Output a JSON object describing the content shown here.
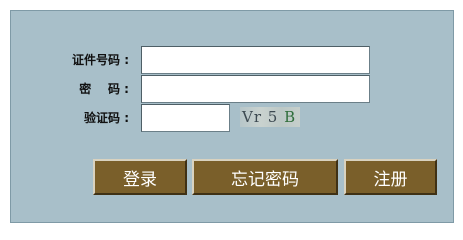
{
  "form": {
    "id_label": "证件号码 :",
    "id_value": "",
    "password_label": "密    码 :",
    "password_value": "",
    "captcha_label": "验证码 :",
    "captcha_value": "",
    "captcha_text_a": "Vr 5 ",
    "captcha_text_b": "B"
  },
  "buttons": {
    "login": "登录",
    "forgot_password": "忘记密码",
    "register": "注册"
  },
  "colors": {
    "panel_bg": "#a8bfc9",
    "button_bg": "#7a5f2a"
  }
}
